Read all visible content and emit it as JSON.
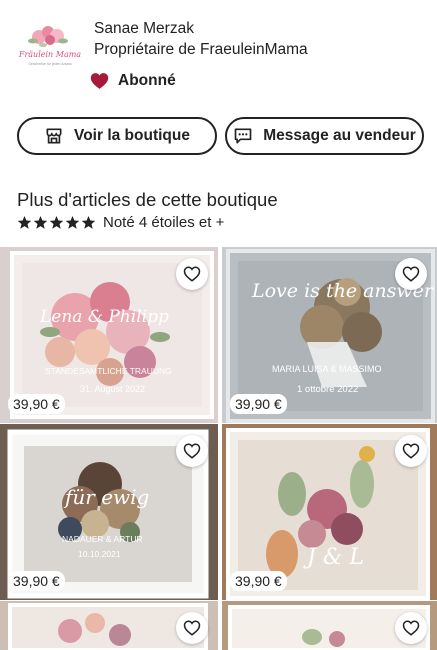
{
  "seller": {
    "name": "Sanae Merzak",
    "role": "Propriétaire de FraeuleinMama",
    "logo_text": "Fräulein Mama",
    "logo_subtext": "Geschenke für jeden Anlass",
    "follow_label": "Abonné"
  },
  "actions": {
    "shop_label": "Voir la boutique",
    "message_label": "Message au vendeur"
  },
  "section": {
    "title": "Plus d'articles de cette boutique",
    "rating_label": "Noté 4 étoiles et +",
    "stars": 5
  },
  "products": [
    {
      "price": "39,90 €",
      "text_line1": "Lena & Philipp",
      "text_line2": "STANDESAMTLICHE TRAUUNG",
      "text_line3": "31. August 2022"
    },
    {
      "price": "39,90 €",
      "text_line1": "Love is the answer",
      "text_line2": "MARIA LUISA & MASSIMO",
      "text_line3": "1 ottobre 2022"
    },
    {
      "price": "39,90 €",
      "text_line1": "für ewig",
      "text_line2": "NADAUER & ARTUR",
      "text_line3": "10.10.2021"
    },
    {
      "price": "39,90 €",
      "text_line1": "J & L",
      "text_line2": "",
      "text_line3": ""
    }
  ],
  "colors": {
    "accent_heart": "#a61a3a",
    "text": "#222222",
    "logo_pink": "#d6517a"
  },
  "icons": {
    "follow": "heart-filled-icon",
    "shop": "store-icon",
    "message": "message-icon",
    "star": "star-icon",
    "favorite": "heart-outline-icon"
  }
}
